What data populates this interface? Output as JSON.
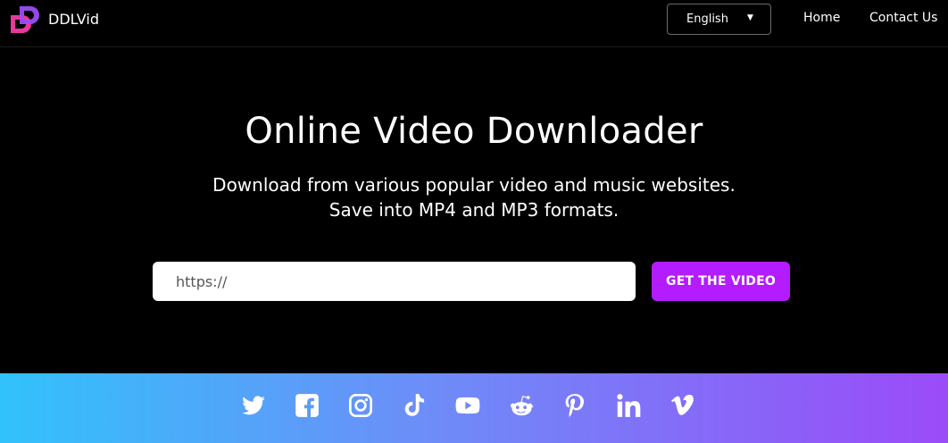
{
  "header": {
    "brand_name": "DDLVid",
    "language": {
      "selected": "English"
    },
    "nav": [
      {
        "label": "Home"
      },
      {
        "label": "Contact Us"
      }
    ]
  },
  "hero": {
    "title": "Online Video Downloader",
    "subtitle_lines": [
      "Download from various popular video and music websites.",
      "Save into MP4 and MP3 formats."
    ]
  },
  "form": {
    "url_placeholder": "https://",
    "url_value": "",
    "submit_label": "GET THE VIDEO"
  },
  "footer": {
    "socials": [
      {
        "icon": "twitter-icon"
      },
      {
        "icon": "facebook-icon"
      },
      {
        "icon": "instagram-icon"
      },
      {
        "icon": "tiktok-icon"
      },
      {
        "icon": "youtube-icon"
      },
      {
        "icon": "reddit-icon"
      },
      {
        "icon": "pinterest-icon"
      },
      {
        "icon": "linkedin-icon"
      },
      {
        "icon": "vimeo-icon"
      }
    ]
  },
  "colors": {
    "accent": "#b31cff",
    "logo_pink": "#e8389a",
    "logo_purple": "#9c4cf6",
    "gradient_start": "#31c2fb",
    "gradient_end": "#9b4bf8"
  }
}
